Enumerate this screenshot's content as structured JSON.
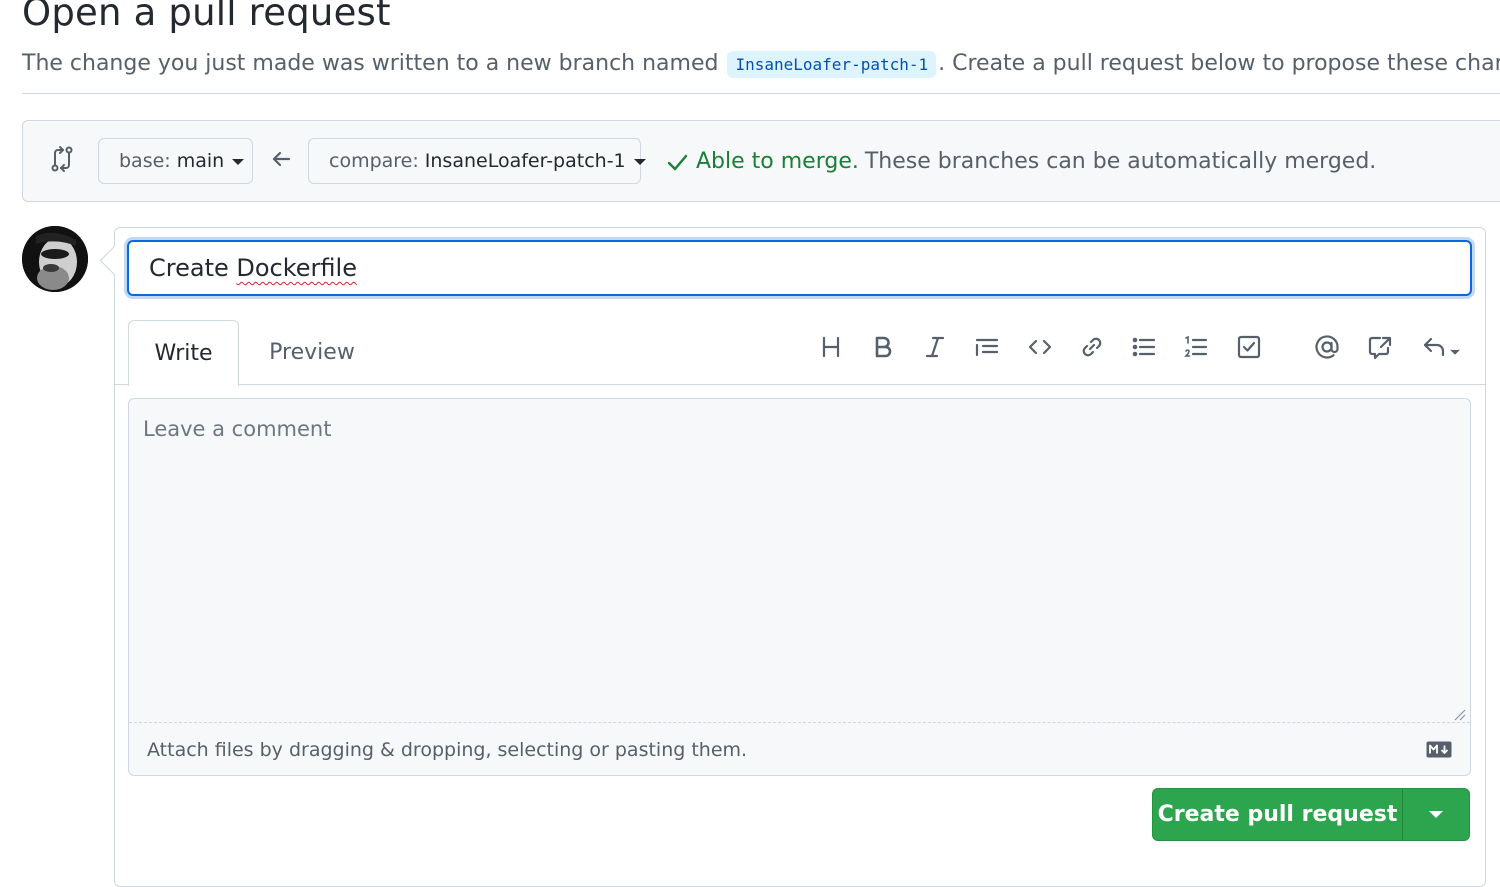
{
  "header": {
    "title": "Open a pull request",
    "subtitle_before": "The change you just made was written to a new branch named ",
    "branch_name": "InsaneLoafer-patch-1",
    "subtitle_after": ". Create a pull request below to propose these changes."
  },
  "range": {
    "base_label": "base:",
    "base_value": "main",
    "compare_label": "compare:",
    "compare_value": "InsaneLoafer-patch-1",
    "merge_title": "Able to merge.",
    "merge_desc": "These branches can be automatically merged."
  },
  "form": {
    "title_prefix": "Create ",
    "title_spellword": "Dockerfile",
    "tabs": [
      {
        "label": "Write",
        "active": true
      },
      {
        "label": "Preview",
        "active": false
      }
    ],
    "comment_placeholder": "Leave a comment",
    "attach_text": "Attach files by dragging & dropping, selecting or pasting them.",
    "submit_label": "Create pull request"
  },
  "toolbar": {
    "icons": [
      "heading-icon",
      "bold-icon",
      "italic-icon",
      "quote-icon",
      "code-icon",
      "link-icon",
      "unordered-list-icon",
      "ordered-list-icon",
      "task-list-icon",
      "mention-icon",
      "cross-reference-icon",
      "reply-icon"
    ]
  },
  "colors": {
    "accent_blue": "#0969da",
    "success_green": "#1a7f37",
    "button_green": "#2da44e",
    "border": "#d0d7de",
    "muted_text": "#57606a"
  }
}
